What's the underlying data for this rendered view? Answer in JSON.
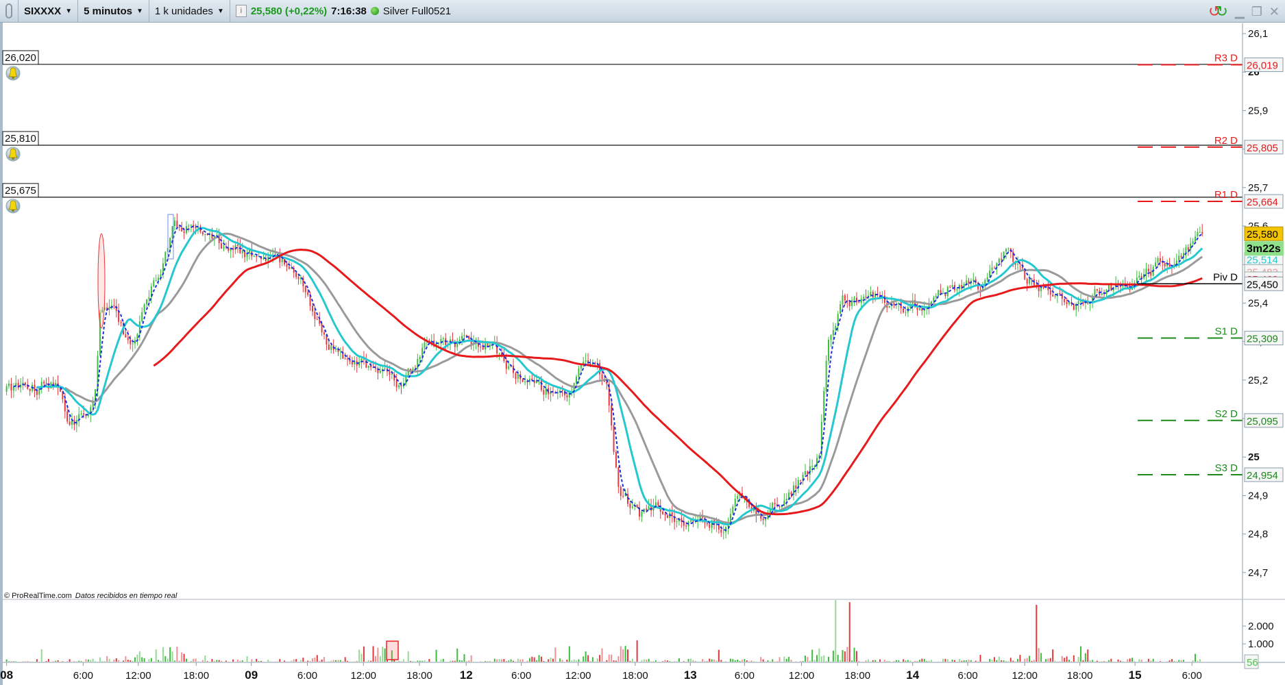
{
  "toolbar": {
    "instrument": "SIXXXX",
    "timeframe": "5 minutos",
    "units": "1 k unidades",
    "info_icon": "i",
    "last_price": "25,580 (+0,22%)",
    "time": "7:16:38",
    "status_color": "#2ea01f",
    "feed": "Silver Full0521"
  },
  "window_controls": [
    "refresh-icon",
    "minimize-icon",
    "restore-icon",
    "close-icon"
  ],
  "watermark": {
    "brand": "© ProRealTime.com",
    "note": "Datos recibidos en tiempo real"
  },
  "colors": {
    "up": "#3cbc3c",
    "down": "#e0393e",
    "fast_ma": "#1a2fe0",
    "cyan_ma": "#25c8cf",
    "gray_ma": "#9a9a9a",
    "slow_ma": "#e8191b",
    "resistance": "#e8191b",
    "support": "#1b8a1b",
    "pivot": "#000000"
  },
  "price_axis": {
    "min": 24.65,
    "max": 26.15,
    "ticks": [
      {
        "v": 26.1,
        "label": "26,1"
      },
      {
        "v": 26.0,
        "label": "26",
        "bold": true
      },
      {
        "v": 25.9,
        "label": "25,9"
      },
      {
        "v": 25.8,
        "label": "25,8"
      },
      {
        "v": 25.7,
        "label": "25,7"
      },
      {
        "v": 25.6,
        "label": "25,6"
      },
      {
        "v": 25.5,
        "label": "25,5"
      },
      {
        "v": 25.4,
        "label": "25,4"
      },
      {
        "v": 25.3,
        "label": "25,3"
      },
      {
        "v": 25.2,
        "label": "25,2"
      },
      {
        "v": 25.1,
        "label": "25,1"
      },
      {
        "v": 25.0,
        "label": "25",
        "bold": true
      },
      {
        "v": 24.9,
        "label": "24,9"
      },
      {
        "v": 24.8,
        "label": "24,8"
      },
      {
        "v": 24.7,
        "label": "24,7"
      }
    ]
  },
  "alerts": [
    {
      "v": 26.02,
      "label": "26,020"
    },
    {
      "v": 25.81,
      "label": "25,810"
    },
    {
      "v": 25.675,
      "label": "25,675"
    }
  ],
  "pivots": [
    {
      "name": "R3 D",
      "v": 26.019,
      "label": "26,019",
      "kind": "resistance"
    },
    {
      "name": "R2 D",
      "v": 25.805,
      "label": "25,805",
      "kind": "resistance"
    },
    {
      "name": "R1 D",
      "v": 25.664,
      "label": "25,664",
      "kind": "resistance"
    },
    {
      "name": "Piv D",
      "v": 25.45,
      "label": "25,450",
      "kind": "pivot"
    },
    {
      "name": "S1 D",
      "v": 25.309,
      "label": "25,309",
      "kind": "support"
    },
    {
      "name": "S2 D",
      "v": 25.095,
      "label": "25,095",
      "kind": "support"
    },
    {
      "name": "S3 D",
      "v": 24.954,
      "label": "24,954",
      "kind": "support"
    }
  ],
  "price_badges": [
    {
      "v": 25.514,
      "label": "25,514",
      "color": "#25c8cf"
    },
    {
      "v": 25.482,
      "label": "25,482",
      "color": "#e89a9a"
    },
    {
      "v": 25.463,
      "label": "25,463",
      "color": "#e8191b"
    }
  ],
  "last_badge": {
    "v": 25.58,
    "label": "25,580",
    "countdown": "3m22s"
  },
  "volume_axis": {
    "ticks": [
      {
        "v": 2000,
        "label": "2.000"
      },
      {
        "v": 1000,
        "label": "1.000"
      }
    ],
    "last": "56"
  },
  "time_axis": [
    {
      "t": 0,
      "label": "08",
      "day": true
    },
    {
      "t": 8.2,
      "label": "6:00"
    },
    {
      "t": 14.1,
      "label": "12:00"
    },
    {
      "t": 20.3,
      "label": "18:00"
    },
    {
      "t": 26.2,
      "label": "09",
      "day": true
    },
    {
      "t": 32.2,
      "label": "6:00"
    },
    {
      "t": 38.2,
      "label": "12:00"
    },
    {
      "t": 44.2,
      "label": "18:00"
    },
    {
      "t": 49.2,
      "label": "12",
      "day": true
    },
    {
      "t": 55.1,
      "label": "6:00"
    },
    {
      "t": 61.2,
      "label": "12:00"
    },
    {
      "t": 67.3,
      "label": "18:00"
    },
    {
      "t": 73.2,
      "label": "13",
      "day": true
    },
    {
      "t": 79.0,
      "label": "6:00"
    },
    {
      "t": 85.1,
      "label": "12:00"
    },
    {
      "t": 91.1,
      "label": "18:00"
    },
    {
      "t": 97.0,
      "label": "14",
      "day": true
    },
    {
      "t": 102.9,
      "label": "6:00"
    },
    {
      "t": 109.0,
      "label": "12:00"
    },
    {
      "t": 114.9,
      "label": "18:00"
    },
    {
      "t": 120.8,
      "label": "15",
      "day": true
    },
    {
      "t": 126.9,
      "label": "6:00"
    }
  ],
  "chart_data": {
    "type": "candlestick",
    "x_unit": "trading hours since 08 00:00",
    "bar_interval_hours": 0.25,
    "price_path": [
      [
        0,
        25.17
      ],
      [
        5.4,
        25.19
      ],
      [
        6.8,
        25.08
      ],
      [
        9.4,
        25.14
      ],
      [
        10,
        25.38
      ],
      [
        11.1,
        25.39
      ],
      [
        13.3,
        25.29
      ],
      [
        16,
        25.46
      ],
      [
        17.7,
        25.59
      ],
      [
        19.5,
        25.61
      ],
      [
        22.1,
        25.55
      ],
      [
        27.4,
        25.52
      ],
      [
        30.9,
        25.49
      ],
      [
        34.4,
        25.29
      ],
      [
        37,
        25.23
      ],
      [
        39.6,
        25.23
      ],
      [
        42.3,
        25.17
      ],
      [
        44.9,
        25.29
      ],
      [
        48.4,
        25.3
      ],
      [
        51.9,
        25.29
      ],
      [
        53.7,
        25.23
      ],
      [
        57.2,
        25.17
      ],
      [
        59.8,
        25.17
      ],
      [
        62.5,
        25.25
      ],
      [
        64.2,
        25.19
      ],
      [
        65.5,
        24.91
      ],
      [
        67.7,
        24.85
      ],
      [
        69.5,
        24.87
      ],
      [
        72.1,
        24.84
      ],
      [
        75.6,
        24.84
      ],
      [
        76.5,
        24.8
      ],
      [
        78.2,
        24.89
      ],
      [
        80.9,
        24.85
      ],
      [
        82.6,
        24.89
      ],
      [
        84.4,
        24.93
      ],
      [
        87,
        25.0
      ],
      [
        87.9,
        25.29
      ],
      [
        89.6,
        25.4
      ],
      [
        92.3,
        25.41
      ],
      [
        95.8,
        25.4
      ],
      [
        99.3,
        25.4
      ],
      [
        101.1,
        25.45
      ],
      [
        104.6,
        25.44
      ],
      [
        107.2,
        25.55
      ],
      [
        108.9,
        25.46
      ],
      [
        112.5,
        25.42
      ],
      [
        114.2,
        25.4
      ],
      [
        116.8,
        25.43
      ],
      [
        120.4,
        25.45
      ],
      [
        123.9,
        25.51
      ],
      [
        125.6,
        25.51
      ],
      [
        128.2,
        25.58
      ]
    ],
    "moving_averages_bars": {
      "fast": 4,
      "cyan": 14,
      "gray": 26,
      "slow": 64
    }
  }
}
